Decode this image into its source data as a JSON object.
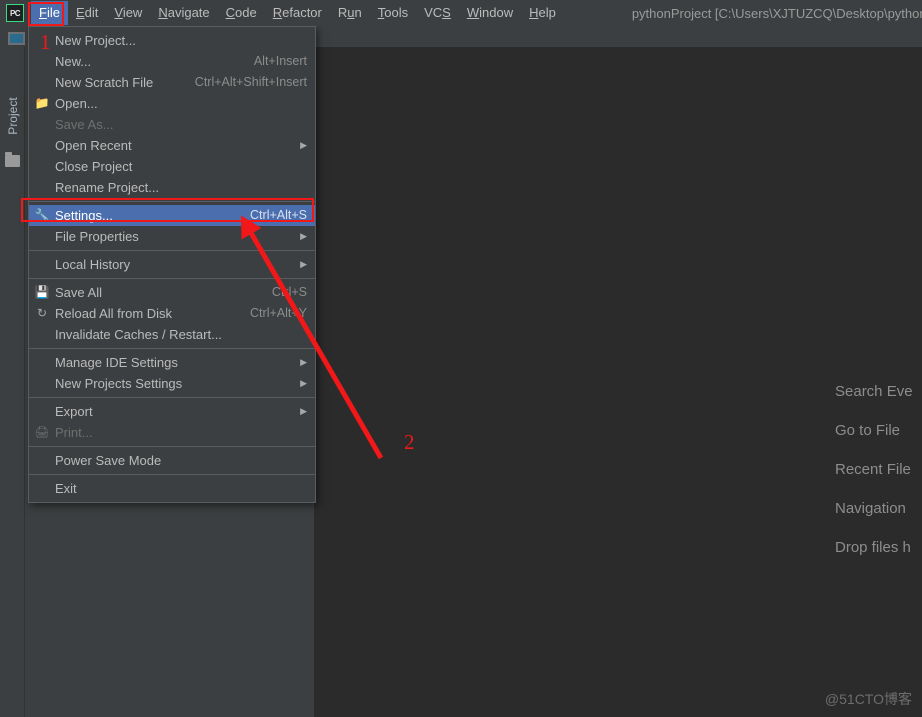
{
  "window": {
    "project_title": "pythonProject [C:\\Users\\XJTUZCQ\\Desktop\\pythonProject]",
    "logo_text": "PC",
    "watermark": "@51CTO博客"
  },
  "menubar": {
    "items": [
      {
        "label": "File",
        "mnemonic": "F",
        "active": true
      },
      {
        "label": "Edit",
        "mnemonic": "E",
        "active": false
      },
      {
        "label": "View",
        "mnemonic": "V",
        "active": false
      },
      {
        "label": "Navigate",
        "mnemonic": "N",
        "active": false
      },
      {
        "label": "Code",
        "mnemonic": "C",
        "active": false
      },
      {
        "label": "Refactor",
        "mnemonic": "R",
        "active": false
      },
      {
        "label": "Run",
        "mnemonic": "u",
        "active": false
      },
      {
        "label": "Tools",
        "mnemonic": "T",
        "active": false
      },
      {
        "label": "VCS",
        "mnemonic": "S",
        "active": false
      },
      {
        "label": "Window",
        "mnemonic": "W",
        "active": false
      },
      {
        "label": "Help",
        "mnemonic": "H",
        "active": false
      }
    ]
  },
  "file_menu": {
    "items": [
      {
        "label": "New Project...",
        "shortcut": "",
        "icon": "",
        "submenu": false,
        "disabled": false,
        "selected": false
      },
      {
        "label": "New...",
        "shortcut": "Alt+Insert",
        "icon": "",
        "submenu": false,
        "disabled": false,
        "selected": false
      },
      {
        "label": "New Scratch File",
        "shortcut": "Ctrl+Alt+Shift+Insert",
        "icon": "",
        "submenu": false,
        "disabled": false,
        "selected": false
      },
      {
        "label": "Open...",
        "shortcut": "",
        "icon": "folder-icon",
        "submenu": false,
        "disabled": false,
        "selected": false
      },
      {
        "label": "Save As...",
        "shortcut": "",
        "icon": "",
        "submenu": false,
        "disabled": true,
        "selected": false
      },
      {
        "label": "Open Recent",
        "shortcut": "",
        "icon": "",
        "submenu": true,
        "disabled": false,
        "selected": false
      },
      {
        "label": "Close Project",
        "shortcut": "",
        "icon": "",
        "submenu": false,
        "disabled": false,
        "selected": false
      },
      {
        "label": "Rename Project...",
        "shortcut": "",
        "icon": "",
        "submenu": false,
        "disabled": false,
        "selected": false
      },
      {
        "separator": true
      },
      {
        "label": "Settings...",
        "shortcut": "Ctrl+Alt+S",
        "icon": "wrench-icon",
        "submenu": false,
        "disabled": false,
        "selected": true
      },
      {
        "label": "File Properties",
        "shortcut": "",
        "icon": "",
        "submenu": true,
        "disabled": false,
        "selected": false
      },
      {
        "separator": true
      },
      {
        "label": "Local History",
        "shortcut": "",
        "icon": "",
        "submenu": true,
        "disabled": false,
        "selected": false
      },
      {
        "separator": true
      },
      {
        "label": "Save All",
        "shortcut": "Ctrl+S",
        "icon": "save-icon",
        "submenu": false,
        "disabled": false,
        "selected": false
      },
      {
        "label": "Reload All from Disk",
        "shortcut": "Ctrl+Alt+Y",
        "icon": "refresh-icon",
        "submenu": false,
        "disabled": false,
        "selected": false
      },
      {
        "label": "Invalidate Caches / Restart...",
        "shortcut": "",
        "icon": "",
        "submenu": false,
        "disabled": false,
        "selected": false
      },
      {
        "separator": true
      },
      {
        "label": "Manage IDE Settings",
        "shortcut": "",
        "icon": "",
        "submenu": true,
        "disabled": false,
        "selected": false
      },
      {
        "label": "New Projects Settings",
        "shortcut": "",
        "icon": "",
        "submenu": true,
        "disabled": false,
        "selected": false
      },
      {
        "separator": true
      },
      {
        "label": "Export",
        "shortcut": "",
        "icon": "",
        "submenu": true,
        "disabled": false,
        "selected": false
      },
      {
        "label": "Print...",
        "shortcut": "",
        "icon": "printer-icon",
        "submenu": false,
        "disabled": true,
        "selected": false
      },
      {
        "separator": true
      },
      {
        "label": "Power Save Mode",
        "shortcut": "",
        "icon": "",
        "submenu": false,
        "disabled": false,
        "selected": false
      },
      {
        "separator": true
      },
      {
        "label": "Exit",
        "shortcut": "",
        "icon": "",
        "submenu": false,
        "disabled": false,
        "selected": false
      }
    ]
  },
  "tool_window": {
    "project_tab_label": "Project"
  },
  "welcome_hints": [
    "Search Eve",
    "Go to File",
    "Recent File",
    "Navigation",
    "Drop files h"
  ],
  "annotations": {
    "step_one": "1",
    "step_two": "2",
    "highlight_color": "#f01818"
  }
}
